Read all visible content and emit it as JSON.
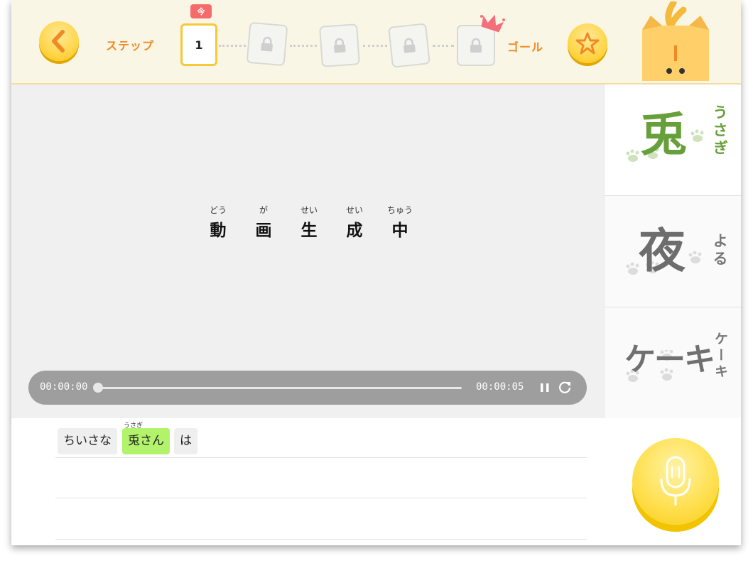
{
  "header": {
    "step_label": "ステップ",
    "now_badge": "今",
    "current_step": "1",
    "goal_label": "ゴール",
    "locked_steps": 4
  },
  "video": {
    "status_chars": [
      {
        "kanji": "動",
        "ruby": "どう"
      },
      {
        "kanji": "画",
        "ruby": "が"
      },
      {
        "kanji": "生",
        "ruby": "せい"
      },
      {
        "kanji": "成",
        "ruby": "せい"
      },
      {
        "kanji": "中",
        "ruby": "ちゅう"
      }
    ],
    "time_current": "00:00:00",
    "time_total": "00:00:05",
    "progress": 0
  },
  "words": [
    {
      "word": "兎",
      "reading": "うさぎ",
      "color": "#67a03a",
      "selected": true
    },
    {
      "word": "夜",
      "reading": "よる",
      "color": "#6d6d6d",
      "selected": false
    },
    {
      "word": "ケーキ",
      "reading": "ケーキ",
      "color": "#707070",
      "selected": false
    }
  ],
  "sentence": {
    "chips": [
      {
        "text": "ちいさな",
        "highlight": false
      },
      {
        "text": "兎さん",
        "ruby": "うさぎ",
        "highlight": true
      },
      {
        "text": "は",
        "highlight": false
      }
    ]
  },
  "colors": {
    "accent_orange": "#f08a24",
    "button_yellow": "#ffd23b",
    "highlight_green": "#b1f36b",
    "badge_red": "#f56b6b"
  }
}
